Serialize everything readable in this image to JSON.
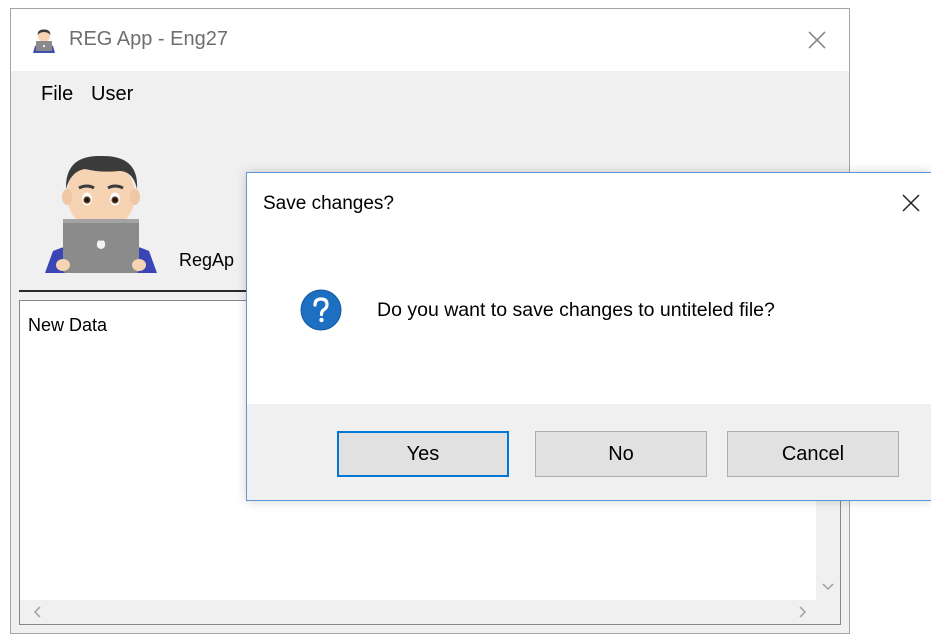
{
  "window": {
    "title": "REG App - Eng27",
    "menu": [
      "File",
      "User"
    ],
    "app_label": "RegAp",
    "data_text": "New Data"
  },
  "dialog": {
    "title": "Save changes?",
    "message": "Do you want to save changes to untiteled file?",
    "buttons": {
      "yes": "Yes",
      "no": "No",
      "cancel": "Cancel"
    },
    "icon": "question-icon"
  },
  "colors": {
    "accent": "#0078d7",
    "question_icon": "#1d6fc1",
    "dialog_border": "#5e95d3"
  }
}
